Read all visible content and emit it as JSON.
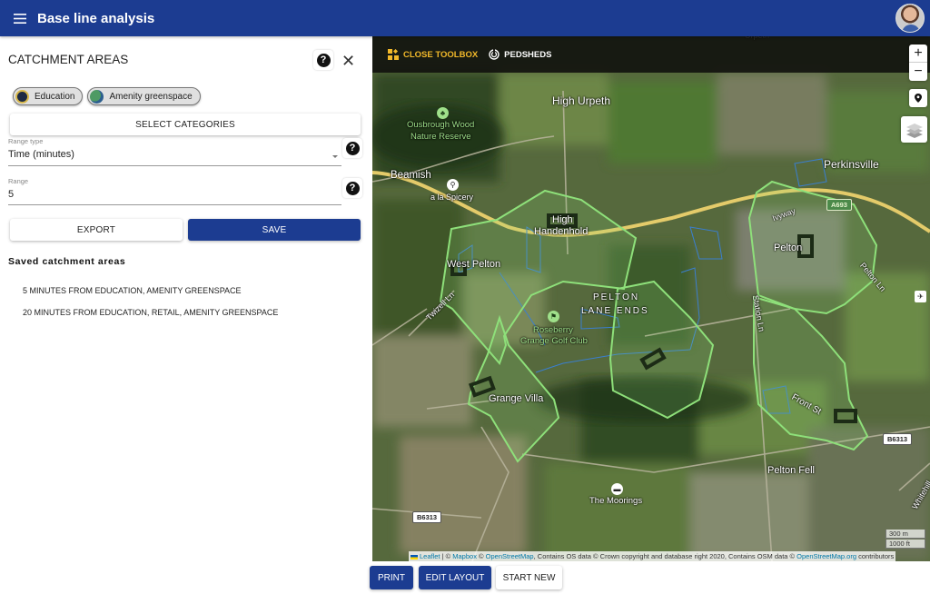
{
  "appbar": {
    "title": "Base line analysis",
    "menu_icon": "hamburger-menu-icon",
    "avatar_icon": "user-avatar"
  },
  "panel": {
    "title": "CATCHMENT AREAS",
    "help_icon": "question-circle-icon",
    "close_icon": "close-icon",
    "close_glyph": "✕",
    "help_glyph": "?",
    "chips": [
      {
        "label": "Education",
        "icon": "education-icon"
      },
      {
        "label": "Amenity greenspace",
        "icon": "greenspace-icon"
      }
    ],
    "select_categories_label": "SELECT CATEGORIES",
    "range_type": {
      "label": "Range type",
      "value": "Time (minutes)"
    },
    "range": {
      "label": "Range",
      "value": "5"
    },
    "export_label": "EXPORT",
    "save_label": "SAVE",
    "saved_title": "Saved catchment areas",
    "saved_items": [
      "5 MINUTES FROM EDUCATION, AMENITY GREENSPACE",
      "20 MINUTES FROM EDUCATION, RETAIL, AMENITY GREENSPACE"
    ]
  },
  "map": {
    "toolbox": {
      "close_toolbox_label": "CLOSE TOOLBOX",
      "pedsheds_label": "PEDSHEDS"
    },
    "zoom_in": "+",
    "zoom_out": "−",
    "place_labels": {
      "urpeth_top": "Urpeth",
      "high_urpeth": "High Urpeth",
      "ousbrough_1": "Ousbrough Wood",
      "ousbrough_2": "Nature Reserve",
      "beamish": "Beamish",
      "spicery": "a la Spicery",
      "perkinsville": "Perkinsville",
      "high": "High",
      "handenhold": "Handenhold",
      "pelton": "Pelton",
      "ivyway": "Ivyway",
      "west_pelton": "West Pelton",
      "twizell_ln": "Twizell Ln",
      "pelton_lane_ends_1": "PELTON",
      "pelton_lane_ends_2": "LANE ENDS",
      "roseberry_1": "Roseberry",
      "roseberry_2": "Grange Golf Club",
      "station_ln": "Station Ln",
      "pelton_ln": "Pelton Ln",
      "grange_villa": "Grange Villa",
      "front_st": "Front St",
      "pelton_fell": "Pelton Fell",
      "the_moorings": "The Moorings",
      "whitehill": "Whitehill"
    },
    "road_badges": {
      "a693": "A693",
      "b6313_left": "B6313",
      "b6313_right": "B6313"
    },
    "scale": {
      "metric": "300 m",
      "imperial": "1000 ft"
    },
    "attribution": {
      "leaflet": "Leaflet",
      "sep": " | © ",
      "mapbox": "Mapbox",
      "mid": " © ",
      "osm": "OpenStreetMap",
      "text": ", Contains OS data © Crown copyright and database right 2020, Contains OSM data © ",
      "osm_org": "OpenStreetMap.org",
      "end": " contributors"
    }
  },
  "bottom": {
    "print_label": "PRINT",
    "edit_layout_label": "EDIT LAYOUT",
    "start_new_label": "START NEW"
  },
  "colors": {
    "primary": "#1c3c91",
    "toolbox_accent": "#f2b92a",
    "catchment_outline": "#8ee07a",
    "boundary_blue": "#3a7fd0"
  }
}
